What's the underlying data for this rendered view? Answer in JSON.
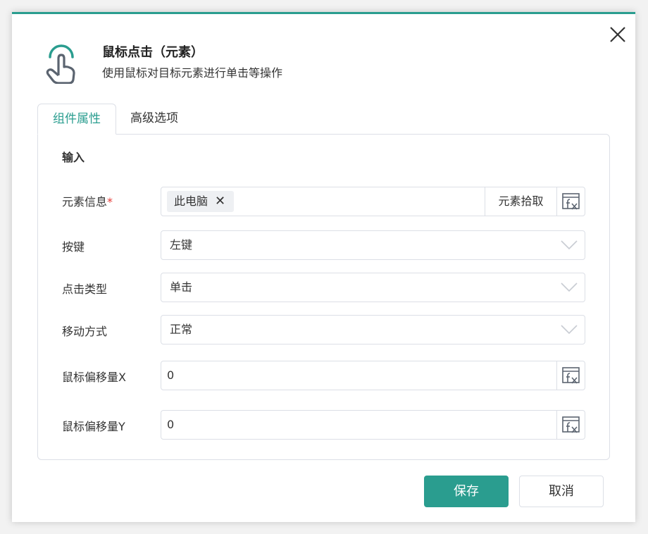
{
  "dialog": {
    "title": "鼠标点击（元素）",
    "subtitle": "使用鼠标对目标元素进行单击等操作",
    "accent_color": "#2a9d8f"
  },
  "tabs": [
    {
      "label": "组件属性",
      "active": true
    },
    {
      "label": "高级选项",
      "active": false
    }
  ],
  "section": {
    "title": "输入"
  },
  "fields": {
    "element": {
      "label": "元素信息",
      "required_mark": "*",
      "tag": "此电脑",
      "pick_label": "元素拾取"
    },
    "key": {
      "label": "按键",
      "value": "左键"
    },
    "click_type": {
      "label": "点击类型",
      "value": "单击"
    },
    "move_mode": {
      "label": "移动方式",
      "value": "正常"
    },
    "offset_x": {
      "label": "鼠标偏移量X",
      "value": "0"
    },
    "offset_y": {
      "label": "鼠标偏移量Y",
      "value": "0"
    }
  },
  "buttons": {
    "save": "保存",
    "cancel": "取消"
  },
  "icons": {
    "close": "close-icon",
    "header": "tap-hand-icon",
    "fx": "fx-expression-icon",
    "chevron": "chevron-down-icon"
  }
}
